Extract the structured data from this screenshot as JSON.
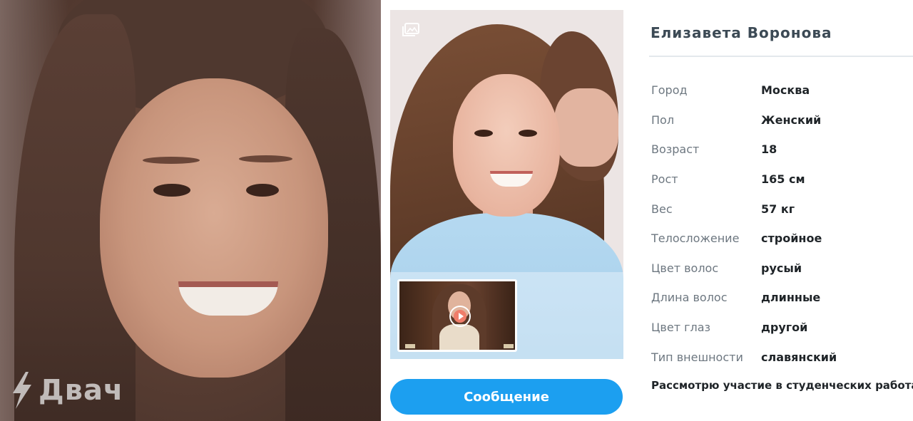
{
  "watermark": {
    "text": "Двач"
  },
  "gallery": {
    "icon": "gallery-icon",
    "video_icon": "play-icon"
  },
  "message_button": {
    "label": "Сообщение",
    "color": "#1c9ff0"
  },
  "profile": {
    "name": "Елизавета Воронова",
    "attributes": [
      {
        "label": "Город",
        "value": "Москва"
      },
      {
        "label": "Пол",
        "value": "Женский"
      },
      {
        "label": "Возраст",
        "value": "18"
      },
      {
        "label": "Рост",
        "value": "165 см"
      },
      {
        "label": "Вес",
        "value": "57 кг"
      },
      {
        "label": "Телосложение",
        "value": "стройное"
      },
      {
        "label": "Цвет волос",
        "value": "русый"
      },
      {
        "label": "Длина волос",
        "value": "длинные"
      },
      {
        "label": "Цвет глаз",
        "value": "другой"
      },
      {
        "label": "Тип внешности",
        "value": "славянский"
      }
    ],
    "note": "Рассмотрю участие в студенческих работах"
  }
}
